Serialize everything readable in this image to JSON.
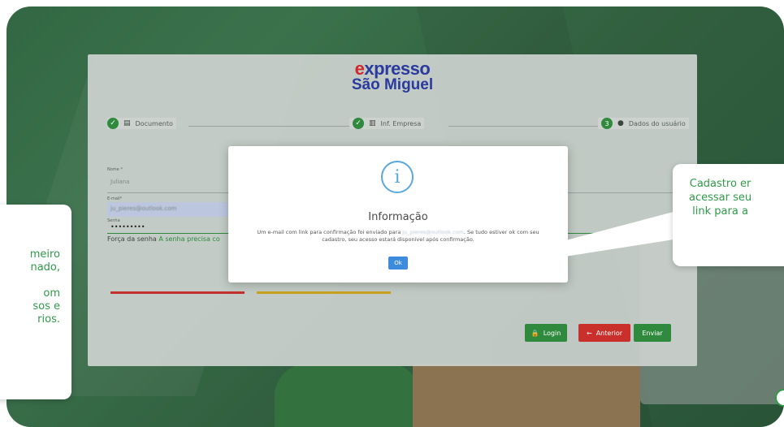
{
  "logo": {
    "brand_ex": "e",
    "brand_rest": "xpresso",
    "brand_sub": "São Miguel"
  },
  "steps": [
    {
      "label": "Documento",
      "state": "done"
    },
    {
      "label": "Inf. Empresa",
      "state": "done"
    },
    {
      "label": "Dados do usuário",
      "state": "active",
      "number": "3"
    }
  ],
  "form": {
    "name_label": "Nome *",
    "name_value": "Juliana",
    "email_label": "E-mail*",
    "email_value": "ju_pieres@outlook.com",
    "password_label": "Senha",
    "password_value": "•••••••••",
    "strength_label": "Força da senha",
    "strength_warning": "A senha precisa co"
  },
  "buttons": {
    "login": "Login",
    "previous": "Anterior",
    "send": "Enviar"
  },
  "modal": {
    "icon": "i",
    "title": "Informação",
    "message_before": "Um e-mail com link para confirmação foi enviado para ",
    "message_email": "ju_pieres@outlook.com",
    "message_after": ". Se tudo estiver ok com seu cadastro, seu acesso estará disponível após confirmação.",
    "ok_label": "Ok"
  },
  "callouts": {
    "left": "meiro\nnado,\n\nom\nsos e\nrios.",
    "right": "Cadastro er\nacessar seu\nlink para a"
  },
  "colors": {
    "brand_green": "#2f8a3e",
    "brand_red": "#c9302c",
    "brand_blue": "#2a3a9e",
    "info_blue": "#5aa8dc"
  }
}
